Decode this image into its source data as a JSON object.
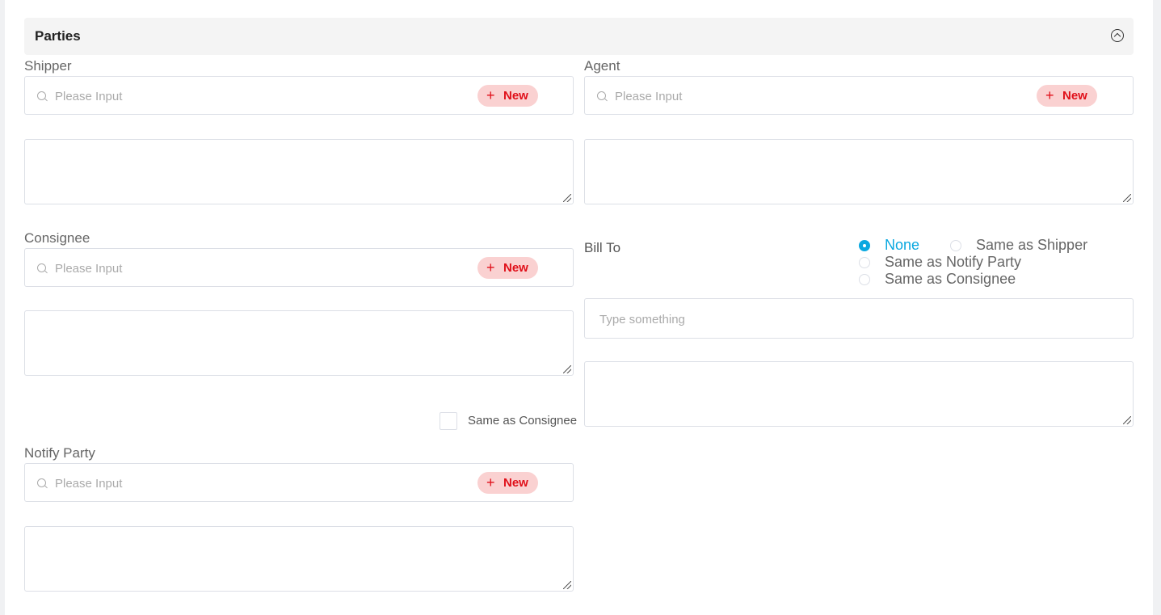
{
  "section": {
    "title": "Parties"
  },
  "shipper": {
    "label": "Shipper",
    "search_placeholder": "Please Input",
    "new_label": "New"
  },
  "agent": {
    "label": "Agent",
    "search_placeholder": "Please Input",
    "new_label": "New"
  },
  "consignee": {
    "label": "Consignee",
    "search_placeholder": "Please Input",
    "new_label": "New"
  },
  "notify_party": {
    "label": "Notify Party",
    "search_placeholder": "Please Input",
    "new_label": "New",
    "same_as_consignee_label": "Same as Consignee",
    "same_as_consignee_checked": false
  },
  "bill_to": {
    "label": "Bill To",
    "options": [
      "None",
      "Same as Shipper",
      "Same as Notify Party",
      "Same as Consignee"
    ],
    "selected": "None",
    "input_placeholder": "Type something"
  },
  "colors": {
    "accent": "#0aa8e0",
    "new_button_bg": "#fad1d1",
    "new_button_text": "#e0101a"
  }
}
